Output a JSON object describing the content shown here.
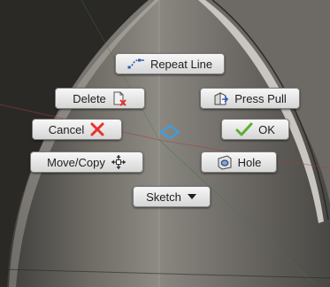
{
  "marking_menu": {
    "repeat_label": "Repeat Line",
    "delete_label": "Delete",
    "presspull_label": "Press Pull",
    "cancel_label": "Cancel",
    "ok_label": "OK",
    "movecopy_label": "Move/Copy",
    "hole_label": "Hole",
    "sketch_label": "Sketch",
    "icons": {
      "repeat": "line-tool-icon",
      "delete": "delete-icon",
      "presspull": "press-pull-icon",
      "cancel": "red-x-icon",
      "ok": "green-check-icon",
      "movecopy": "move-arrows-icon",
      "hole": "hole-icon",
      "sketch": "dropdown-triangle-icon",
      "center": "center-diamond-icon"
    },
    "colors": {
      "button_top": "#f7f7f7",
      "button_bottom": "#d6d6d6",
      "cancel_x": "#e8322c",
      "ok_check": "#5cb030",
      "center_diamond": "#3aa0e0"
    }
  }
}
